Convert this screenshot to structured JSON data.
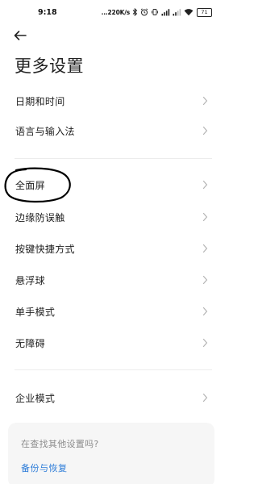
{
  "status_bar": {
    "time": "9:18",
    "net_speed": "...220K/s",
    "battery": "71",
    "icons": [
      "bluetooth-icon",
      "alarm-icon",
      "vibrate-icon",
      "signal-icon",
      "signal-icon",
      "wifi-icon",
      "battery-icon"
    ]
  },
  "header": {
    "back_icon": "arrow-left-icon",
    "title": "更多设置"
  },
  "settings": {
    "items": [
      {
        "label": "日期和时间"
      },
      {
        "label": "语言与输入法"
      },
      {
        "label": "全面屏"
      },
      {
        "label": "边缘防误触"
      },
      {
        "label": "按键快捷方式"
      },
      {
        "label": "悬浮球"
      },
      {
        "label": "单手模式"
      },
      {
        "label": "无障碍"
      },
      {
        "label": "企业模式"
      }
    ]
  },
  "suggestion_card": {
    "question": "在查找其他设置吗?",
    "link": "备份与恢复"
  },
  "colors": {
    "link": "#2b7bd8",
    "annotation": "#000000"
  }
}
